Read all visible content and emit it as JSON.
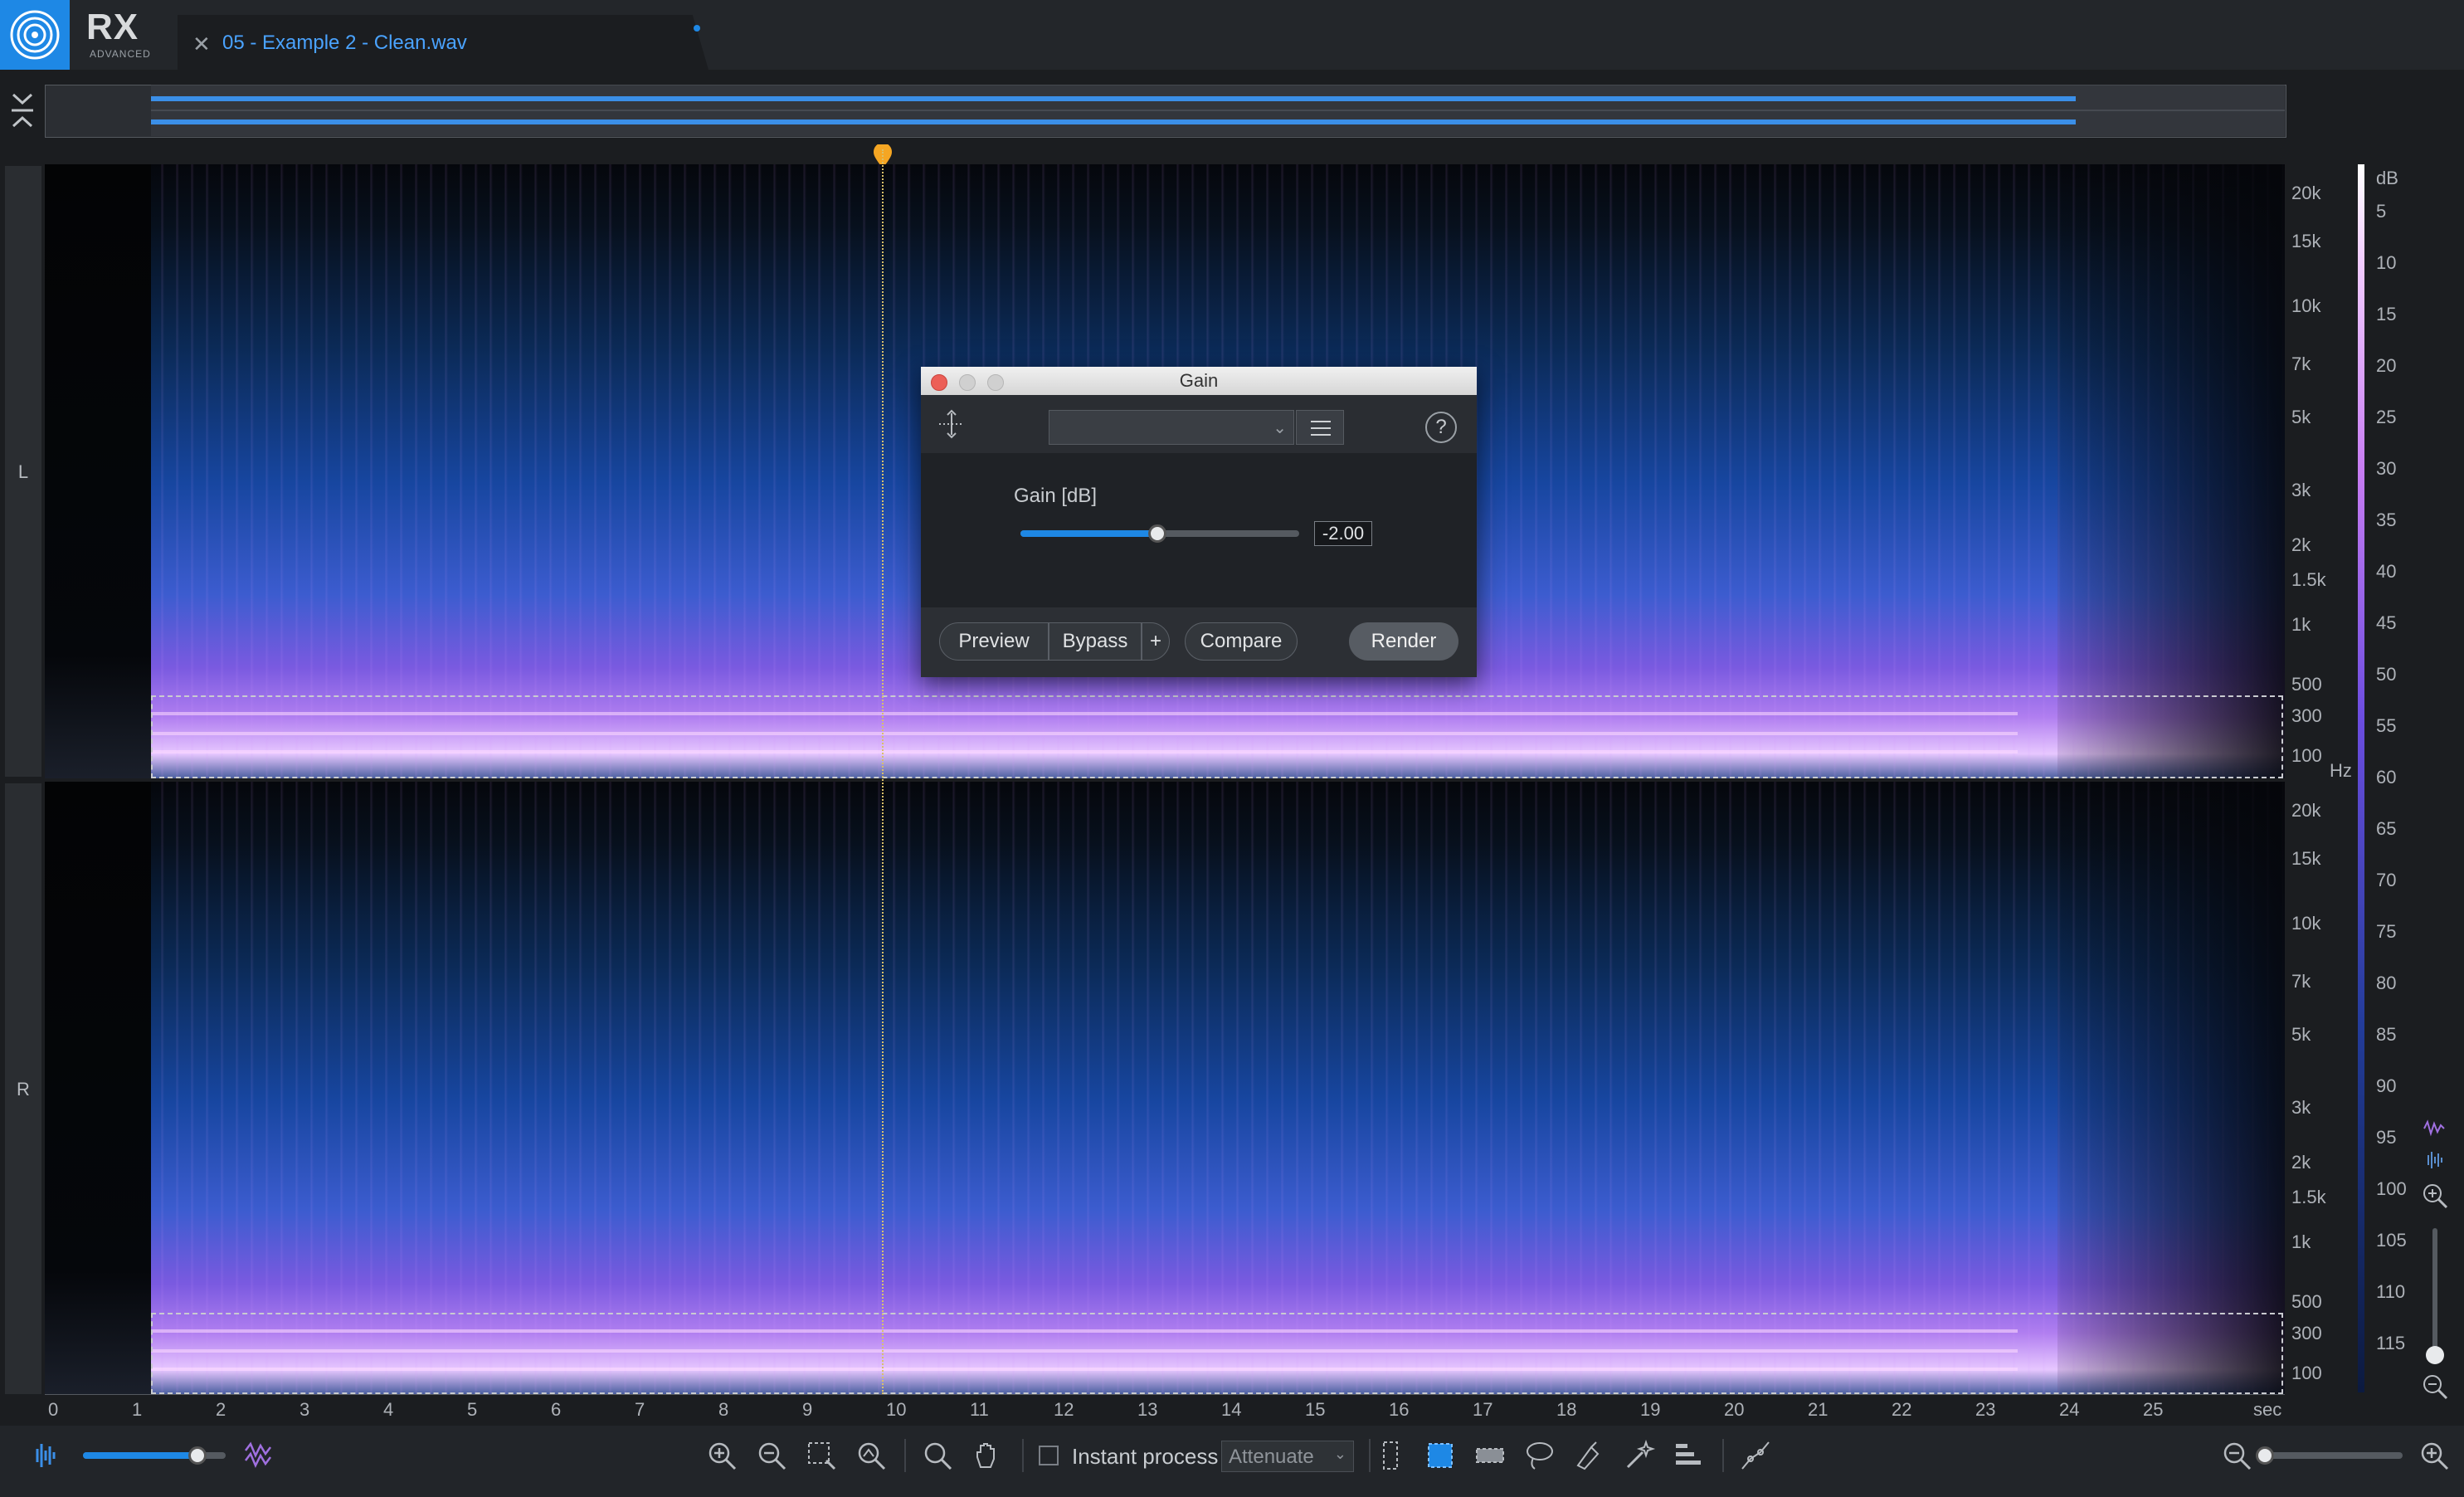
{
  "app": {
    "name": "RX",
    "edition": "ADVANCED"
  },
  "tab": {
    "title": "05 - Example 2 - Clean.wav"
  },
  "channels": [
    "L",
    "R"
  ],
  "freq_ticks": [
    "20k",
    "15k",
    "10k",
    "7k",
    "5k",
    "3k",
    "2k",
    "1.5k",
    "1k",
    "500",
    "300",
    "100"
  ],
  "hz_unit": "Hz",
  "db_unit": "dB",
  "db_ticks": [
    "5",
    "10",
    "15",
    "20",
    "25",
    "30",
    "35",
    "40",
    "45",
    "50",
    "55",
    "60",
    "65",
    "70",
    "75",
    "80",
    "85",
    "90",
    "95",
    "100",
    "105",
    "110",
    "115"
  ],
  "time_ticks": [
    "0",
    "1",
    "2",
    "3",
    "4",
    "5",
    "6",
    "7",
    "8",
    "9",
    "10",
    "11",
    "12",
    "13",
    "14",
    "15",
    "16",
    "17",
    "18",
    "19",
    "20",
    "21",
    "22",
    "23",
    "24",
    "25"
  ],
  "time_unit": "sec",
  "gain_dialog": {
    "title": "Gain",
    "param_label": "Gain [dB]",
    "value": "-2.00",
    "slider_fraction": 0.49,
    "buttons": {
      "preview": "Preview",
      "bypass": "Bypass",
      "plus": "+",
      "compare": "Compare",
      "render": "Render"
    }
  },
  "bottom": {
    "instant_process": "Instant process",
    "mode": "Attenuate",
    "spectrogram_blend_fraction": 0.8,
    "zoom_fraction": 0.0
  },
  "colors": {
    "accent": "#1e88e5",
    "playhead": "#f5a623"
  }
}
